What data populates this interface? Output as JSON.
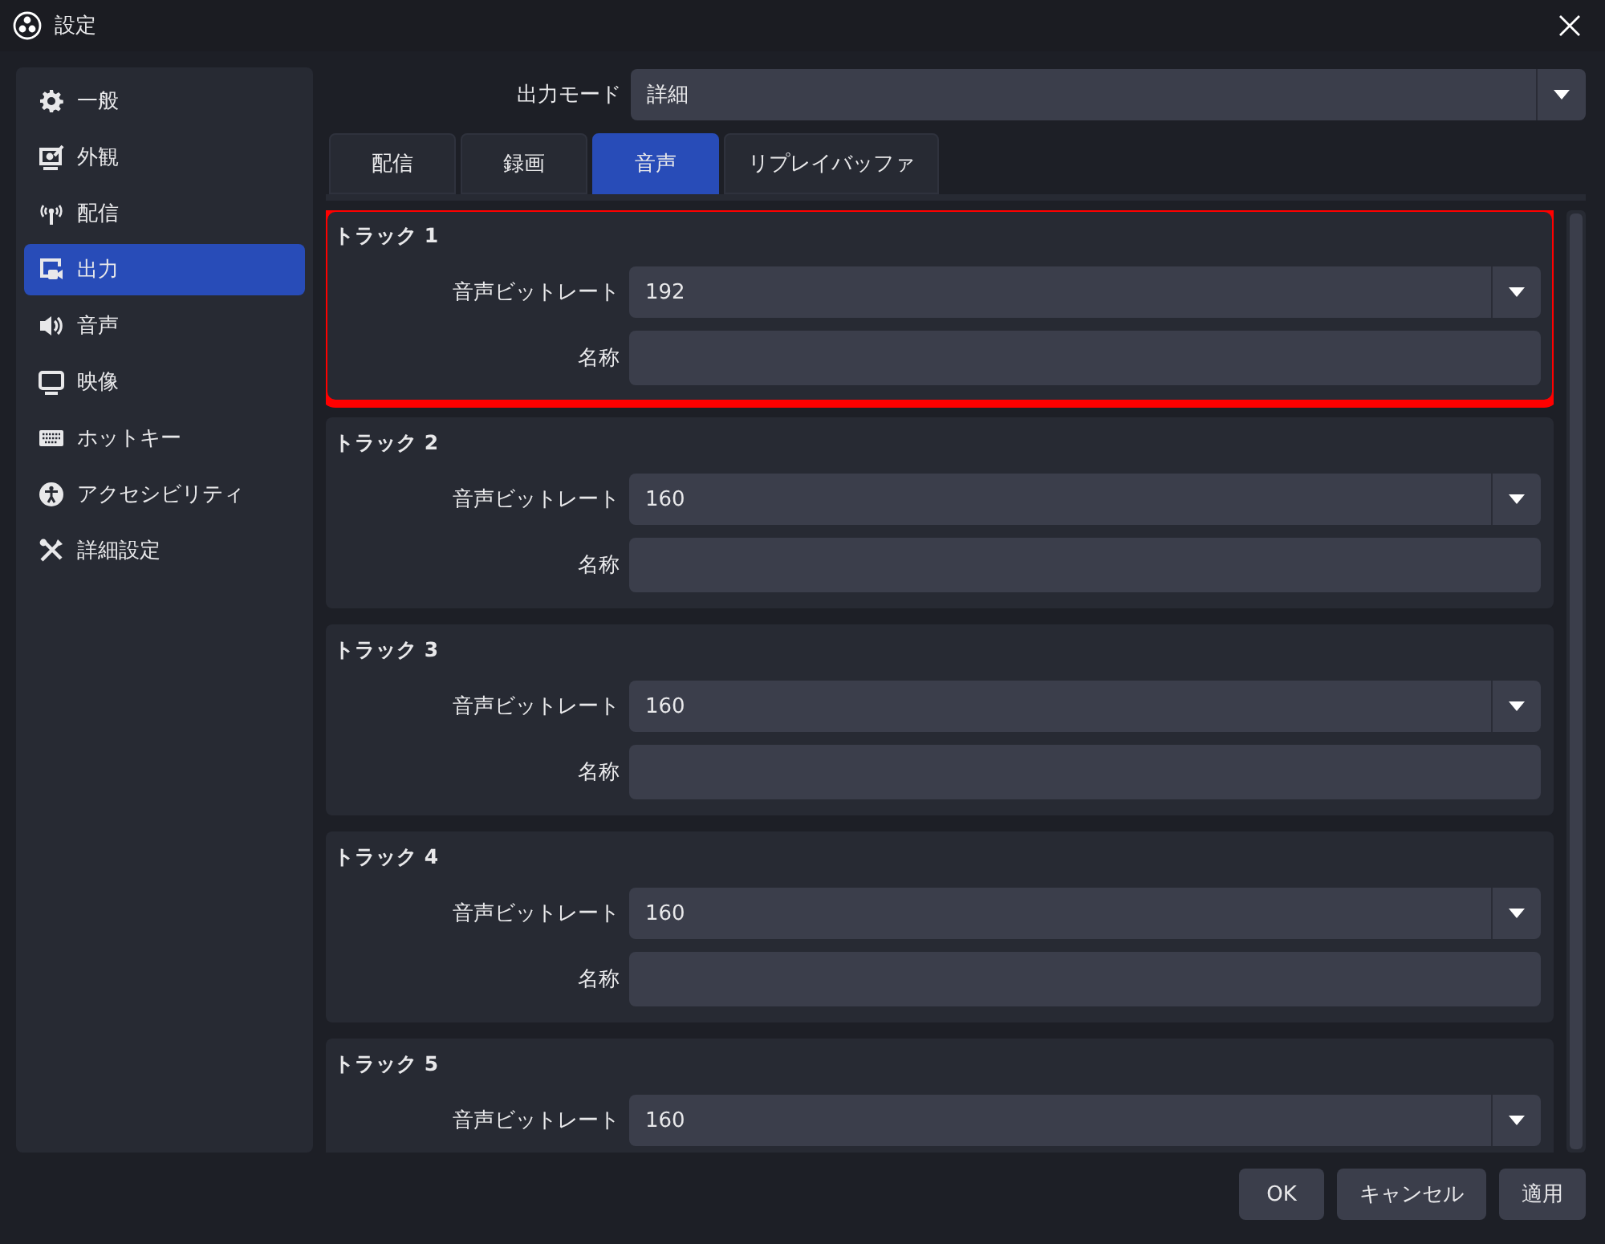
{
  "window": {
    "title": "設定"
  },
  "sidebar": {
    "items": [
      {
        "label": "一般",
        "selected": false
      },
      {
        "label": "外観",
        "selected": false
      },
      {
        "label": "配信",
        "selected": false
      },
      {
        "label": "出力",
        "selected": true
      },
      {
        "label": "音声",
        "selected": false
      },
      {
        "label": "映像",
        "selected": false
      },
      {
        "label": "ホットキー",
        "selected": false
      },
      {
        "label": "アクセシビリティ",
        "selected": false
      },
      {
        "label": "詳細設定",
        "selected": false
      }
    ]
  },
  "output_mode": {
    "label": "出力モード",
    "value": "詳細"
  },
  "tabs": [
    {
      "label": "配信",
      "selected": false
    },
    {
      "label": "録画",
      "selected": false
    },
    {
      "label": "音声",
      "selected": true
    },
    {
      "label": "リプレイバッファ",
      "selected": false
    }
  ],
  "tracks": [
    {
      "title": "トラック 1",
      "highlighted": true,
      "fields": [
        {
          "kind": "dropdown",
          "label": "音声ビットレート",
          "value": "192"
        },
        {
          "kind": "text",
          "label": "名称"
        }
      ]
    },
    {
      "title": "トラック 2",
      "highlighted": false,
      "fields": [
        {
          "kind": "dropdown",
          "label": "音声ビットレート",
          "value": "160"
        },
        {
          "kind": "text",
          "label": "名称"
        }
      ]
    },
    {
      "title": "トラック 3",
      "highlighted": false,
      "fields": [
        {
          "kind": "dropdown",
          "label": "音声ビットレート",
          "value": "160"
        },
        {
          "kind": "text",
          "label": "名称"
        }
      ]
    },
    {
      "title": "トラック 4",
      "highlighted": false,
      "fields": [
        {
          "kind": "dropdown",
          "label": "音声ビットレート",
          "value": "160"
        },
        {
          "kind": "text",
          "label": "名称"
        }
      ]
    },
    {
      "title": "トラック 5",
      "highlighted": false,
      "fields": [
        {
          "kind": "dropdown",
          "label": "音声ビットレート",
          "value": "160"
        }
      ]
    }
  ],
  "buttons": [
    "OK",
    "キャンセル",
    "適用"
  ]
}
